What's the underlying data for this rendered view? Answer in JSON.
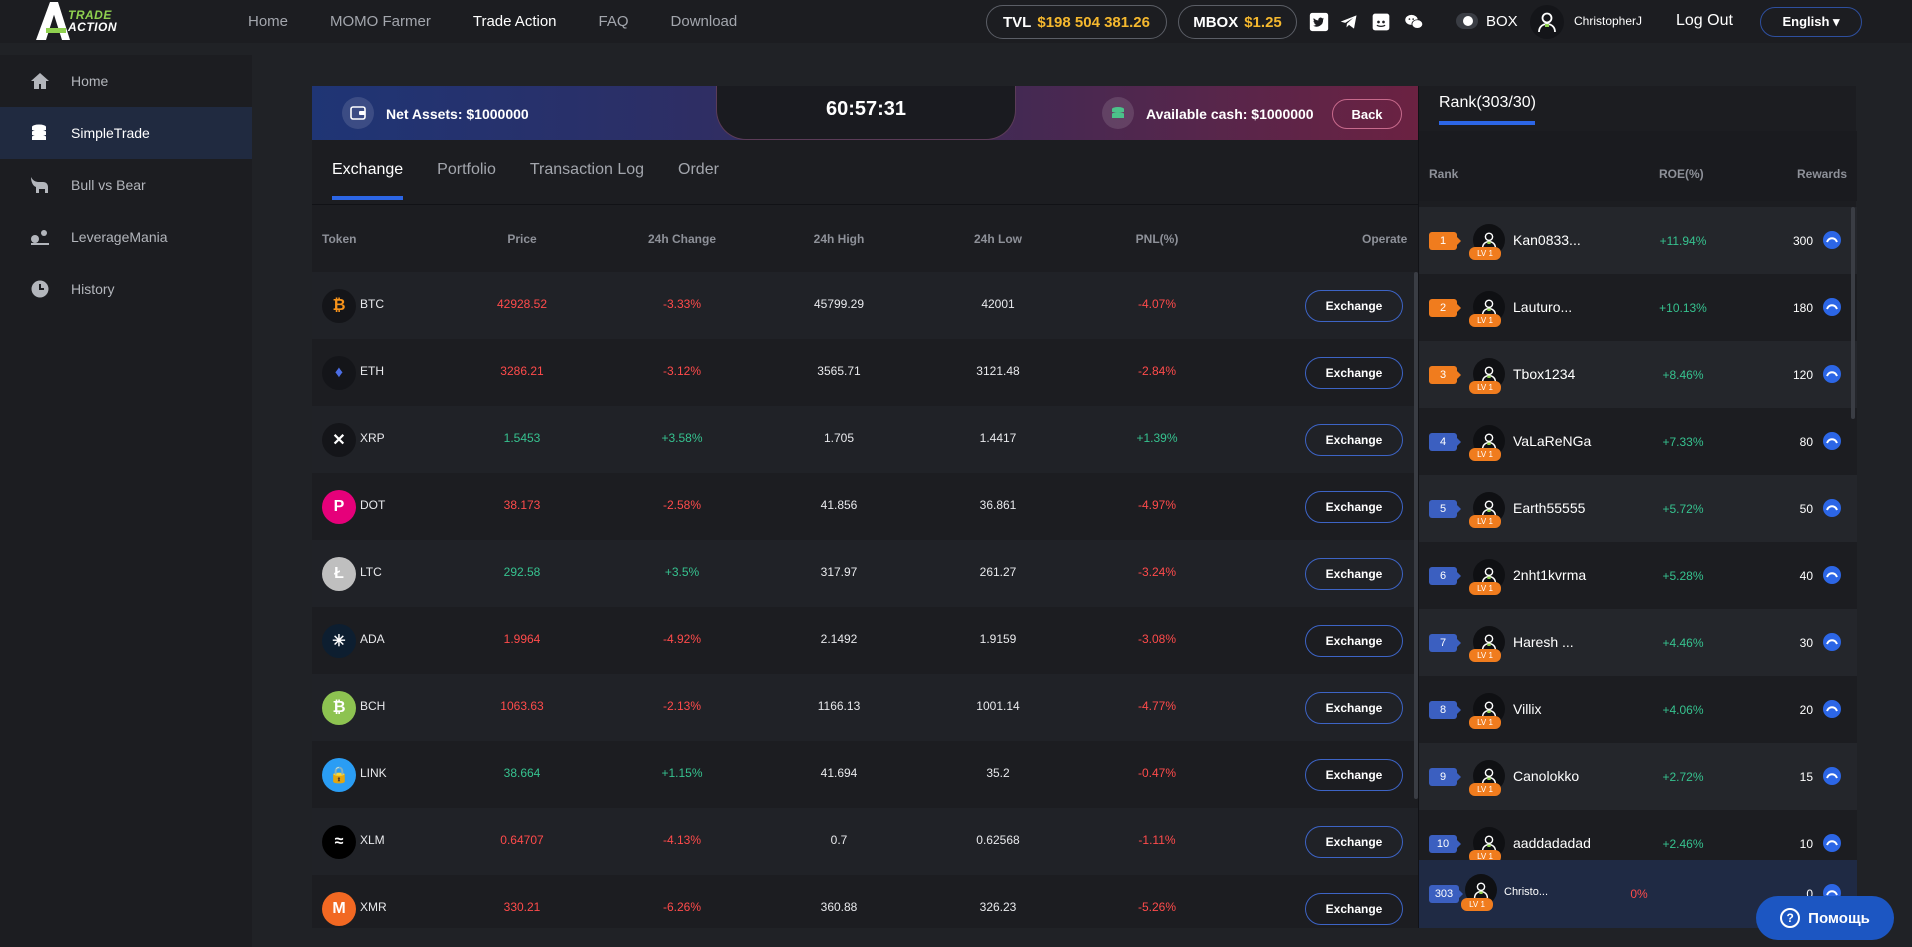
{
  "logo": {
    "line1": "TRADE",
    "line2": "ACTION"
  },
  "nav": {
    "items": [
      {
        "label": "Home",
        "active": false
      },
      {
        "label": "MOMO Farmer",
        "active": false
      },
      {
        "label": "Trade Action",
        "active": true
      },
      {
        "label": "FAQ",
        "active": false
      },
      {
        "label": "Download",
        "active": false
      }
    ],
    "tvl_label": "TVL",
    "tvl_value": "$198 504 381.26",
    "mbox_label": "MBOX",
    "mbox_value": "$1.25",
    "social_icons": [
      "twitter-icon",
      "telegram-icon",
      "discord-icon",
      "wechat-icon"
    ],
    "box_label": "BOX",
    "username": "ChristopherJ",
    "logout_label": "Log Out",
    "language": "English ▾"
  },
  "sidebar": {
    "items": [
      {
        "label": "Home",
        "icon": "home-icon",
        "active": false
      },
      {
        "label": "SimpleTrade",
        "icon": "coins-icon",
        "active": true
      },
      {
        "label": "Bull vs Bear",
        "icon": "bull-icon",
        "active": false
      },
      {
        "label": "LeverageMania",
        "icon": "leverage-icon",
        "active": false
      },
      {
        "label": "History",
        "icon": "clock-icon",
        "active": false
      }
    ]
  },
  "banner": {
    "net_assets": "Net Assets: $1000000",
    "timer": "60:57:31",
    "available_cash": "Available cash: $1000000",
    "back_label": "Back"
  },
  "tabs": [
    {
      "label": "Exchange",
      "active": true
    },
    {
      "label": "Portfolio",
      "active": false
    },
    {
      "label": "Transaction Log",
      "active": false
    },
    {
      "label": "Order",
      "active": false
    }
  ],
  "table": {
    "headers": {
      "token": "Token",
      "price": "Price",
      "change": "24h Change",
      "high": "24h High",
      "low": "24h Low",
      "pnl": "PNL(%)",
      "operate": "Operate"
    },
    "button_label": "Exchange",
    "rows": [
      {
        "symbol": "BTC",
        "price": "42928.52",
        "change": "-3.33%",
        "high": "45799.29",
        "low": "42001",
        "pnl": "-4.07%",
        "price_up": false,
        "change_up": false,
        "pnl_up": false,
        "coin_color": "#f7931a",
        "coin_bg": "#141519",
        "coin_glyph": "₿"
      },
      {
        "symbol": "ETH",
        "price": "3286.21",
        "change": "-3.12%",
        "high": "3565.71",
        "low": "3121.48",
        "pnl": "-2.84%",
        "price_up": false,
        "change_up": false,
        "pnl_up": false,
        "coin_color": "#4c6ee5",
        "coin_bg": "#141519",
        "coin_glyph": "♦"
      },
      {
        "symbol": "XRP",
        "price": "1.5453",
        "change": "+3.58%",
        "high": "1.705",
        "low": "1.4417",
        "pnl": "+1.39%",
        "price_up": true,
        "change_up": true,
        "pnl_up": true,
        "coin_color": "#ffffff",
        "coin_bg": "#141519",
        "coin_glyph": "✕"
      },
      {
        "symbol": "DOT",
        "price": "38.173",
        "change": "-2.58%",
        "high": "41.856",
        "low": "36.861",
        "pnl": "-4.97%",
        "price_up": false,
        "change_up": false,
        "pnl_up": false,
        "coin_color": "#ffffff",
        "coin_bg": "#e6007a",
        "coin_glyph": "P"
      },
      {
        "symbol": "LTC",
        "price": "292.58",
        "change": "+3.5%",
        "high": "317.97",
        "low": "261.27",
        "pnl": "-3.24%",
        "price_up": true,
        "change_up": true,
        "pnl_up": false,
        "coin_color": "#ffffff",
        "coin_bg": "#bfbfbf",
        "coin_glyph": "Ł"
      },
      {
        "symbol": "ADA",
        "price": "1.9964",
        "change": "-4.92%",
        "high": "2.1492",
        "low": "1.9159",
        "pnl": "-3.08%",
        "price_up": false,
        "change_up": false,
        "pnl_up": false,
        "coin_color": "#ffffff",
        "coin_bg": "#0d1e30",
        "coin_glyph": "✳"
      },
      {
        "symbol": "BCH",
        "price": "1063.63",
        "change": "-2.13%",
        "high": "1166.13",
        "low": "1001.14",
        "pnl": "-4.77%",
        "price_up": false,
        "change_up": false,
        "pnl_up": false,
        "coin_color": "#ffffff",
        "coin_bg": "#8dc351",
        "coin_glyph": "₿"
      },
      {
        "symbol": "LINK",
        "price": "38.664",
        "change": "+1.15%",
        "high": "41.694",
        "low": "35.2",
        "pnl": "-0.47%",
        "price_up": true,
        "change_up": true,
        "pnl_up": false,
        "coin_color": "#ffffff",
        "coin_bg": "#2a9df4",
        "coin_glyph": "🔒"
      },
      {
        "symbol": "XLM",
        "price": "0.64707",
        "change": "-4.13%",
        "high": "0.7",
        "low": "0.62568",
        "pnl": "-1.11%",
        "price_up": false,
        "change_up": false,
        "pnl_up": false,
        "coin_color": "#ffffff",
        "coin_bg": "#000000",
        "coin_glyph": "≈"
      },
      {
        "symbol": "XMR",
        "price": "330.21",
        "change": "-6.26%",
        "high": "360.88",
        "low": "326.23",
        "pnl": "-5.26%",
        "price_up": false,
        "change_up": false,
        "pnl_up": false,
        "coin_color": "#ffffff",
        "coin_bg": "#f26822",
        "coin_glyph": "M"
      }
    ]
  },
  "rank": {
    "title": "Rank(303/30)",
    "headers": {
      "rank": "Rank",
      "roe": "ROE(%)",
      "rewards": "Rewards"
    },
    "level_label": "LV 1",
    "rows": [
      {
        "rank": "1",
        "name": "Kan0833...",
        "roe": "+11.94%",
        "reward": "300",
        "top": true
      },
      {
        "rank": "2",
        "name": "Lauturo...",
        "roe": "+10.13%",
        "reward": "180",
        "top": true
      },
      {
        "rank": "3",
        "name": "Tbox1234",
        "roe": "+8.46%",
        "reward": "120",
        "top": true
      },
      {
        "rank": "4",
        "name": "VaLaReNGa",
        "roe": "+7.33%",
        "reward": "80",
        "top": false
      },
      {
        "rank": "5",
        "name": "Earth55555",
        "roe": "+5.72%",
        "reward": "50",
        "top": false
      },
      {
        "rank": "6",
        "name": "2nht1kvrma",
        "roe": "+5.28%",
        "reward": "40",
        "top": false
      },
      {
        "rank": "7",
        "name": "Haresh ...",
        "roe": "+4.46%",
        "reward": "30",
        "top": false
      },
      {
        "rank": "8",
        "name": "Villix",
        "roe": "+4.06%",
        "reward": "20",
        "top": false
      },
      {
        "rank": "9",
        "name": "Canolokko",
        "roe": "+2.72%",
        "reward": "15",
        "top": false
      },
      {
        "rank": "10",
        "name": "aaddadadad",
        "roe": "+2.46%",
        "reward": "10",
        "top": false
      }
    ],
    "me": {
      "rank": "303",
      "name": "Christo...",
      "roe": "0%",
      "reward": "0"
    }
  },
  "help": {
    "label": "Помощь",
    "glyph": "?"
  },
  "colors": {
    "accent": "#2c66e6",
    "up": "#36c28f",
    "down": "#ff4b4b",
    "gold": "#f5b82e",
    "rank_top": "#f07c1e"
  }
}
